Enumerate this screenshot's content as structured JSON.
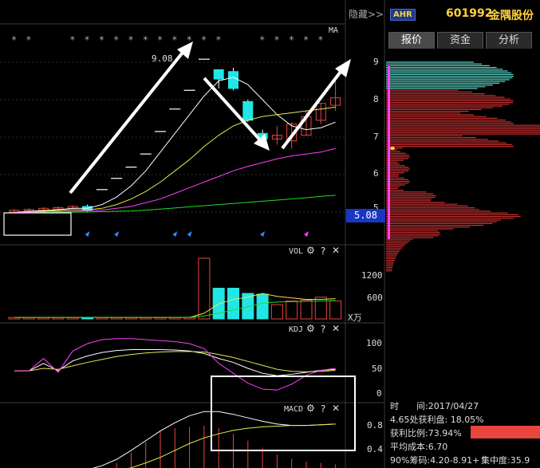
{
  "toolbar": {
    "hide_label": "隐藏>>"
  },
  "stock": {
    "badge": "AHR",
    "code": "601992",
    "name": "金隅股份"
  },
  "tabs": [
    {
      "label": "报价"
    },
    {
      "label": "资金"
    },
    {
      "label": "分析"
    }
  ],
  "main_panel": {
    "ma_label": "MA",
    "high_label": "9.08",
    "price_axis": [
      "9",
      "8",
      "7",
      "6",
      "5"
    ],
    "current_price": "5.08"
  },
  "vol_panel": {
    "title": "VOL",
    "axis": [
      "1200",
      "600"
    ],
    "unit": "X万"
  },
  "kdj_panel": {
    "title": "KDJ",
    "axis": [
      "100",
      "50",
      "0"
    ]
  },
  "macd_panel": {
    "title": "MACD",
    "axis": [
      "0.8",
      "0.4"
    ]
  },
  "chip_info": {
    "time_label": "时　　间:",
    "time_value": "2017/04/27",
    "profit_line": "4.65处获利盘: 18.05%",
    "profit_ratio_label": "获利比例:",
    "profit_ratio_value": "73.94%",
    "avg_cost": "平均成本:6.70",
    "chip90": "90%筹码:4.20-8.91+",
    "concentration": "集中度:35.9"
  },
  "colors": {
    "up": "#e8453c",
    "down": "#22e6e6",
    "ma5": "#ffffff",
    "ma10": "#e8e84a",
    "ma20": "#ff40ff",
    "ma60": "#22dd22",
    "chip_cyan": "#5ad6c8",
    "chip_red": "#cc2f2f"
  },
  "chart_data": [
    {
      "type": "candlestick",
      "title": "",
      "y_ticks": [
        9,
        8,
        7,
        6,
        5
      ],
      "candles": [
        {
          "o": 5.0,
          "c": 5.05,
          "h": 5.08,
          "l": 4.98
        },
        {
          "o": 5.03,
          "c": 5.07,
          "h": 5.1,
          "l": 5.0
        },
        {
          "o": 5.05,
          "c": 5.1,
          "h": 5.13,
          "l": 5.02
        },
        {
          "o": 5.08,
          "c": 5.12,
          "h": 5.15,
          "l": 5.05
        },
        {
          "o": 5.1,
          "c": 5.15,
          "h": 5.18,
          "l": 5.08
        },
        {
          "o": 5.15,
          "c": 5.05,
          "h": 5.2,
          "l": 5.0
        },
        {
          "o": 5.6,
          "c": 5.6,
          "h": 5.6,
          "l": 5.6
        },
        {
          "o": 5.9,
          "c": 5.9,
          "h": 5.9,
          "l": 5.9
        },
        {
          "o": 6.2,
          "c": 6.2,
          "h": 6.2,
          "l": 6.2
        },
        {
          "o": 6.55,
          "c": 6.55,
          "h": 6.55,
          "l": 6.55
        },
        {
          "o": 7.15,
          "c": 7.15,
          "h": 7.15,
          "l": 7.15
        },
        {
          "o": 7.75,
          "c": 7.75,
          "h": 7.75,
          "l": 7.75
        },
        {
          "o": 8.25,
          "c": 8.25,
          "h": 8.25,
          "l": 8.25
        },
        {
          "o": 9.08,
          "c": 9.08,
          "h": 9.08,
          "l": 9.08
        },
        {
          "o": 8.8,
          "c": 8.55,
          "h": 8.8,
          "l": 8.3
        },
        {
          "o": 8.75,
          "c": 8.3,
          "h": 8.85,
          "l": 8.25
        },
        {
          "o": 7.95,
          "c": 7.45,
          "h": 8.0,
          "l": 7.4
        },
        {
          "o": 7.1,
          "c": 6.95,
          "h": 7.2,
          "l": 6.8
        },
        {
          "o": 6.95,
          "c": 7.05,
          "h": 7.3,
          "l": 6.8
        },
        {
          "o": 6.9,
          "c": 7.35,
          "h": 7.4,
          "l": 6.7
        },
        {
          "o": 7.05,
          "c": 7.55,
          "h": 7.7,
          "l": 7.05
        },
        {
          "o": 7.45,
          "c": 7.9,
          "h": 7.9,
          "l": 7.35
        },
        {
          "o": 7.85,
          "c": 8.05,
          "h": 8.5,
          "l": 7.7
        }
      ],
      "series": [
        {
          "name": "MA5",
          "values": [
            5.0,
            5.02,
            5.04,
            5.06,
            5.1,
            5.1,
            5.2,
            5.4,
            5.7,
            6.1,
            6.6,
            7.1,
            7.6,
            8.1,
            8.5,
            8.6,
            8.4,
            8.0,
            7.6,
            7.3,
            7.2,
            7.25,
            7.4
          ]
        },
        {
          "name": "MA10",
          "values": [
            5.0,
            5.0,
            5.02,
            5.04,
            5.06,
            5.06,
            5.1,
            5.2,
            5.35,
            5.55,
            5.8,
            6.1,
            6.4,
            6.75,
            7.05,
            7.3,
            7.45,
            7.55,
            7.6,
            7.65,
            7.7,
            7.75,
            7.8
          ]
        },
        {
          "name": "MA20",
          "values": [
            5.0,
            5.0,
            5.0,
            5.01,
            5.02,
            5.03,
            5.05,
            5.1,
            5.15,
            5.25,
            5.35,
            5.5,
            5.65,
            5.8,
            5.95,
            6.1,
            6.22,
            6.32,
            6.42,
            6.5,
            6.55,
            6.6,
            6.7
          ]
        },
        {
          "name": "MA60",
          "values": [
            4.98,
            4.98,
            4.99,
            4.99,
            5.0,
            5.0,
            5.01,
            5.02,
            5.03,
            5.05,
            5.08,
            5.11,
            5.14,
            5.17,
            5.2,
            5.23,
            5.26,
            5.29,
            5.32,
            5.35,
            5.38,
            5.42,
            5.45
          ]
        }
      ]
    },
    {
      "type": "bar",
      "title": "VOL",
      "y_ticks": [
        1200,
        600
      ],
      "values": [
        40,
        40,
        40,
        40,
        40,
        40,
        40,
        40,
        40,
        40,
        40,
        40,
        40,
        1620,
        820,
        820,
        680,
        660,
        380,
        480,
        500,
        580,
        480
      ],
      "series": [
        {
          "name": "VOL-MA5",
          "values": [
            40,
            40,
            40,
            40,
            40,
            40,
            40,
            40,
            40,
            40,
            40,
            40,
            40,
            150,
            400,
            520,
            580,
            680,
            600,
            560,
            520,
            520,
            540
          ]
        },
        {
          "name": "VOL-MA10",
          "values": [
            40,
            40,
            40,
            40,
            40,
            40,
            40,
            40,
            40,
            40,
            40,
            40,
            40,
            80,
            150,
            240,
            320,
            420,
            450,
            460,
            470,
            480,
            490
          ]
        }
      ]
    },
    {
      "type": "line",
      "title": "KDJ",
      "y_ticks": [
        100,
        50,
        0
      ],
      "series": [
        {
          "name": "K",
          "values": [
            45,
            45,
            60,
            45,
            65,
            75,
            82,
            86,
            88,
            88,
            88,
            87,
            85,
            80,
            70,
            62,
            50,
            40,
            35,
            38,
            42,
            46,
            48
          ]
        },
        {
          "name": "D",
          "values": [
            45,
            45,
            50,
            48,
            55,
            62,
            68,
            74,
            78,
            81,
            83,
            84,
            84,
            83,
            78,
            72,
            64,
            56,
            48,
            44,
            43,
            44,
            46
          ]
        },
        {
          "name": "J",
          "values": [
            45,
            45,
            70,
            42,
            85,
            100,
            108,
            110,
            110,
            108,
            106,
            104,
            100,
            90,
            60,
            40,
            20,
            8,
            6,
            18,
            36,
            46,
            50
          ]
        }
      ]
    },
    {
      "type": "bar",
      "title": "MACD",
      "y_ticks": [
        0.8,
        0.4
      ],
      "values": [
        0,
        0,
        0,
        0,
        0,
        0.05,
        0.1,
        0.2,
        0.35,
        0.5,
        0.65,
        0.7,
        0.72,
        0.74,
        0.7,
        0.62,
        0.52,
        0.42,
        0.32,
        0.26,
        0.22,
        0.2,
        0.18
      ],
      "series": [
        {
          "name": "DIFF",
          "values": [
            0,
            0,
            0.02,
            0.04,
            0.06,
            0.1,
            0.16,
            0.25,
            0.38,
            0.52,
            0.66,
            0.78,
            0.88,
            0.94,
            0.94,
            0.9,
            0.85,
            0.8,
            0.76,
            0.74,
            0.74,
            0.75,
            0.76
          ]
        },
        {
          "name": "DEA",
          "values": [
            0,
            0,
            0,
            0.01,
            0.02,
            0.03,
            0.05,
            0.08,
            0.13,
            0.2,
            0.28,
            0.38,
            0.48,
            0.56,
            0.62,
            0.67,
            0.7,
            0.72,
            0.73,
            0.74,
            0.74,
            0.75,
            0.76
          ]
        }
      ]
    }
  ]
}
